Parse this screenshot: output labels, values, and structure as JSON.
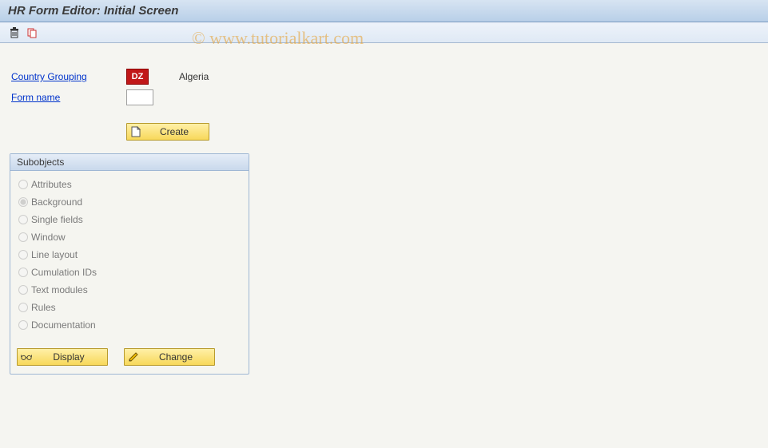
{
  "title": "HR Form Editor: Initial Screen",
  "watermark": "© www.tutorialkart.com",
  "toolbar": {
    "delete_icon": "delete-icon",
    "copy_icon": "copy-icon"
  },
  "fields": {
    "country_grouping": {
      "label": "Country Grouping",
      "code": "DZ",
      "description": "Algeria"
    },
    "form_name": {
      "label": "Form name",
      "value": ""
    }
  },
  "buttons": {
    "create": "Create",
    "display": "Display",
    "change": "Change"
  },
  "subobjects": {
    "title": "Subobjects",
    "items": [
      {
        "label": "Attributes",
        "selected": false
      },
      {
        "label": "Background",
        "selected": true
      },
      {
        "label": "Single fields",
        "selected": false
      },
      {
        "label": "Window",
        "selected": false
      },
      {
        "label": "Line layout",
        "selected": false
      },
      {
        "label": "Cumulation IDs",
        "selected": false
      },
      {
        "label": "Text modules",
        "selected": false
      },
      {
        "label": "Rules",
        "selected": false
      },
      {
        "label": "Documentation",
        "selected": false
      }
    ]
  }
}
